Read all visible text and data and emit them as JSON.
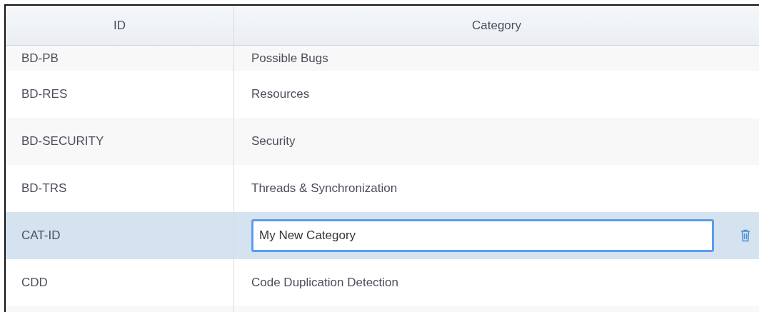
{
  "table": {
    "columns": [
      "ID",
      "Category"
    ],
    "rows": [
      {
        "id": "BD-PB",
        "category": "Possible Bugs",
        "kind": "text",
        "selected": false
      },
      {
        "id": "BD-RES",
        "category": "Resources",
        "kind": "text",
        "selected": false
      },
      {
        "id": "BD-SECURITY",
        "category": "Security",
        "kind": "text",
        "selected": false
      },
      {
        "id": "BD-TRS",
        "category": "Threads & Synchronization",
        "kind": "text",
        "selected": false
      },
      {
        "id": "CAT-ID",
        "category": "My New Category",
        "kind": "editing",
        "selected": true
      },
      {
        "id": "CDD",
        "category": "Code Duplication Detection",
        "kind": "text",
        "selected": false
      }
    ]
  }
}
